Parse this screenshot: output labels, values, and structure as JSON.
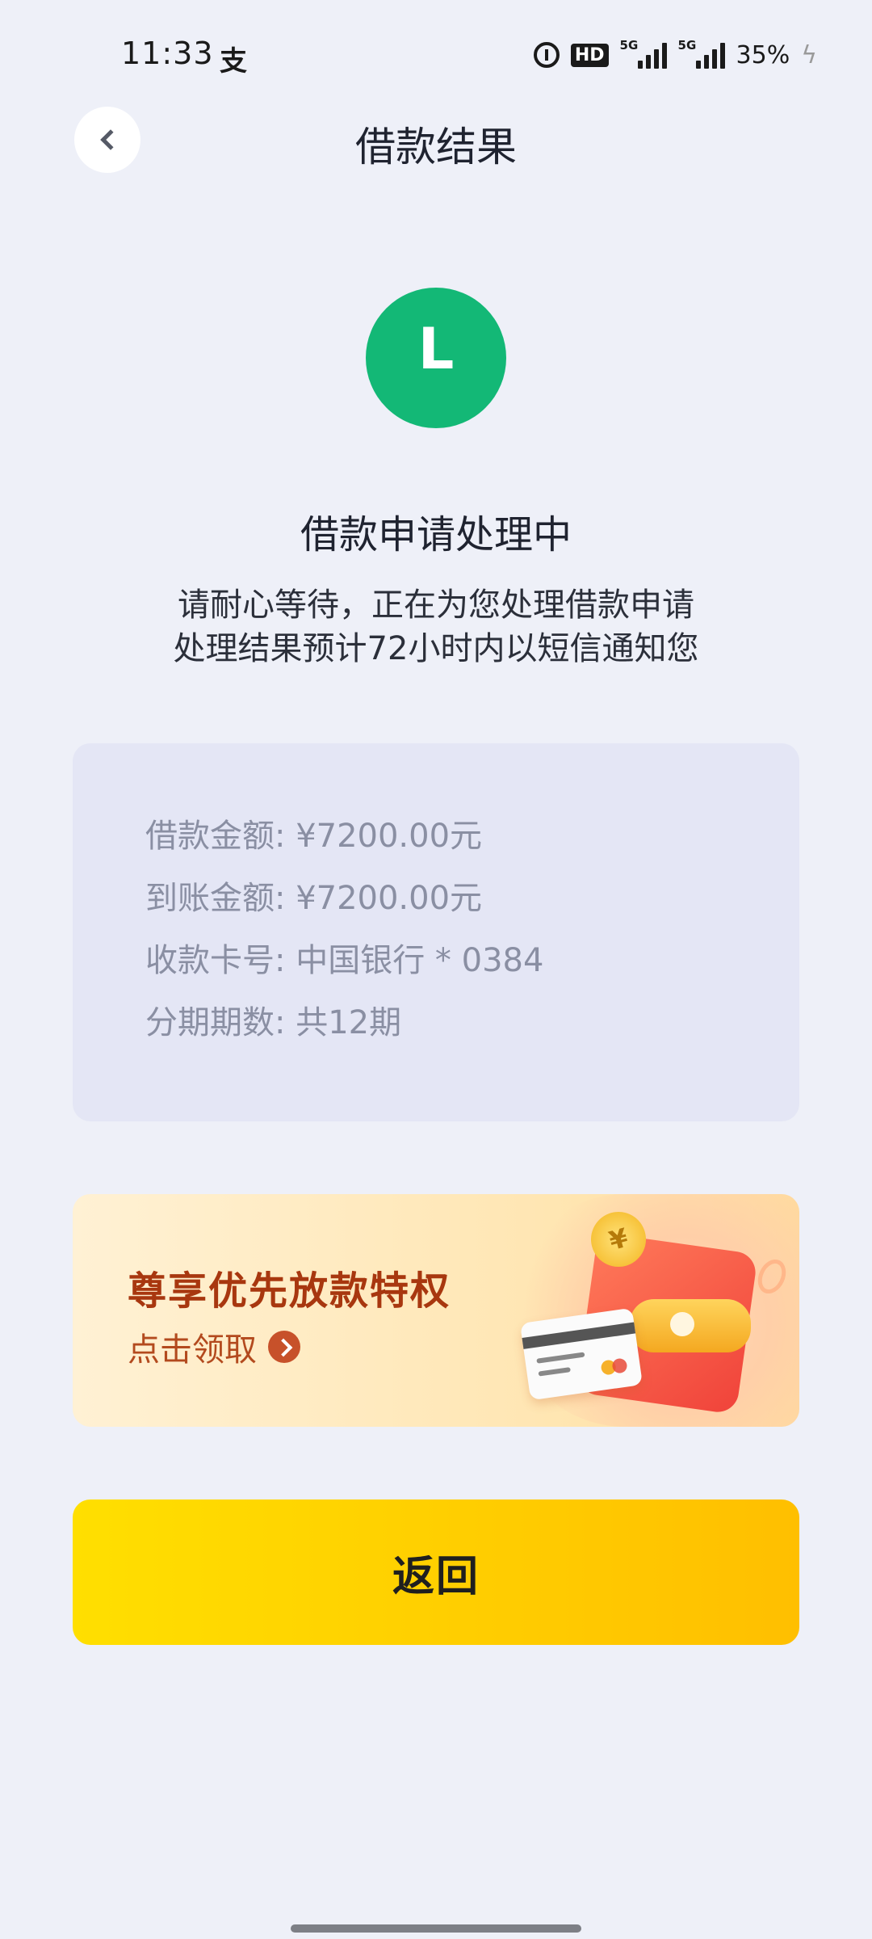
{
  "status_bar": {
    "time": "11:33",
    "app_icon": "alipay-icon",
    "signal1_label": "5G",
    "signal2_label": "5G",
    "hd_label": "HD",
    "battery": "35%"
  },
  "header": {
    "back_icon": "chevron-left-icon",
    "title": "借款结果"
  },
  "logo": {
    "letter": "L",
    "color": "#13b876"
  },
  "status": {
    "heading": "借款申请处理中",
    "line1": "请耐心等待，正在为您处理借款申请",
    "line2": "处理结果预计72小时内以短信通知您"
  },
  "details": {
    "loan_amount": "借款金额: ¥7200.00元",
    "arrival_amount": "到账金额: ¥7200.00元",
    "card_number": "收款卡号: 中国银行 * 0384",
    "installments": "分期期数: 共12期"
  },
  "promo": {
    "title": "尊享优先放款特权",
    "cta": "点击领取",
    "coin_symbol": "¥"
  },
  "actions": {
    "return_label": "返回",
    "accent": "#ffcc00"
  }
}
